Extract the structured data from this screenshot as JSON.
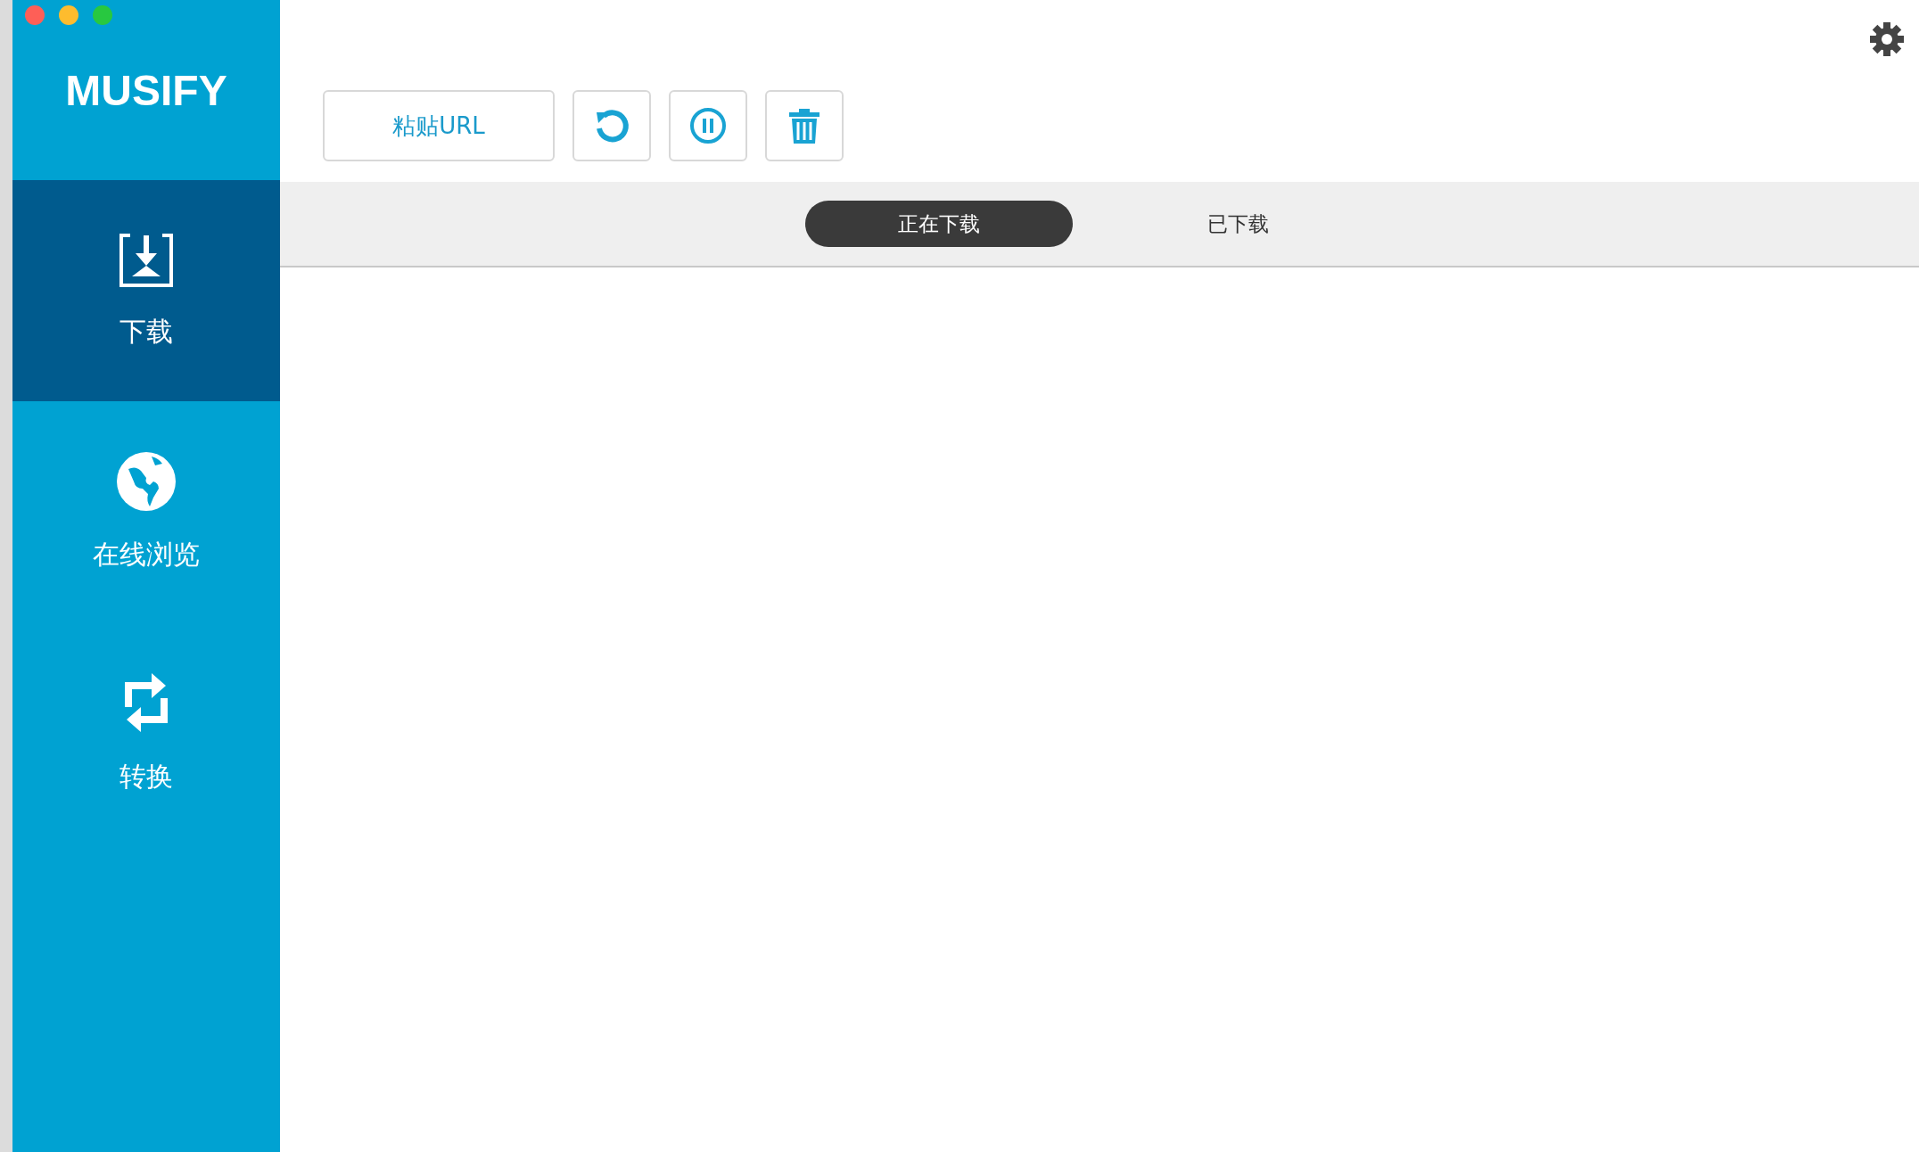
{
  "app": {
    "logo": "MUSIFY"
  },
  "sidebar": {
    "items": [
      {
        "label": "下载",
        "selected": true
      },
      {
        "label": "在线浏览",
        "selected": false
      },
      {
        "label": "转换",
        "selected": false
      }
    ]
  },
  "toolbar": {
    "paste_button": "粘贴URL"
  },
  "tabs": [
    {
      "label": "正在下载",
      "selected": true
    },
    {
      "label": "已下载",
      "selected": false
    }
  ]
}
